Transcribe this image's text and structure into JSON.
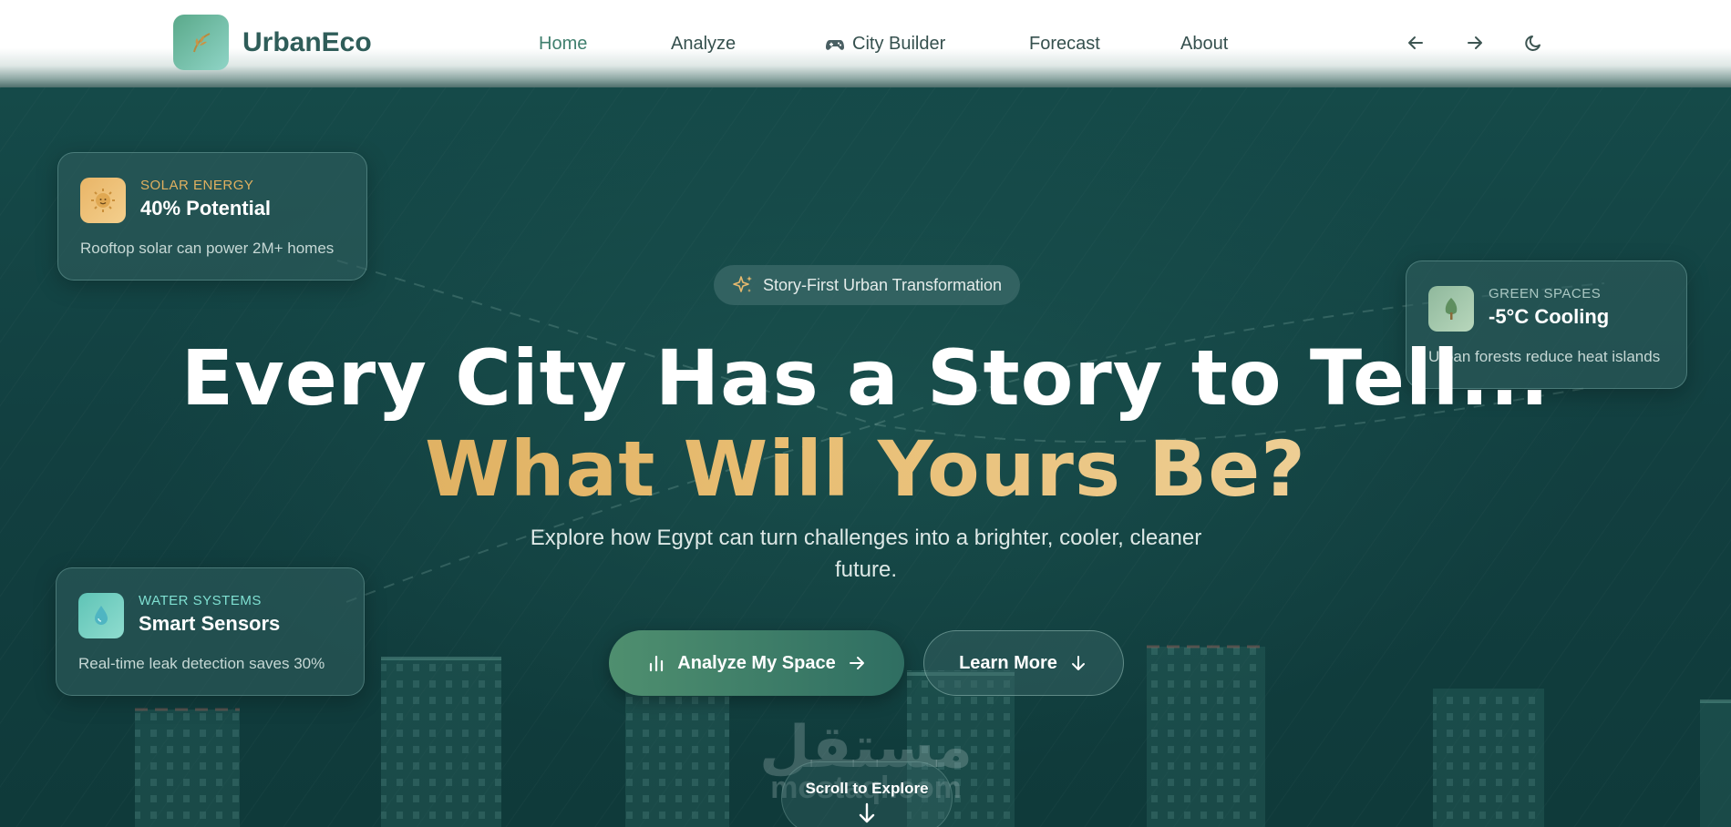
{
  "nav": {
    "brand": "UrbanEco",
    "logo_icon": "leaf-icon",
    "items": [
      {
        "label": "Home",
        "active": true
      },
      {
        "label": "Analyze",
        "active": false
      },
      {
        "label": "City Builder",
        "active": false,
        "icon": "gamepad-icon"
      },
      {
        "label": "Forecast",
        "active": false
      },
      {
        "label": "About",
        "active": false
      }
    ],
    "controls": [
      "arrow-left-icon",
      "arrow-right-icon",
      "moon-icon"
    ]
  },
  "cards": {
    "solar": {
      "kicker": "SOLAR ENERGY",
      "title": "40% Potential",
      "desc": "Rooftop solar can power 2M+ homes",
      "icon": "sun-icon",
      "kicker_color": "#e0b060"
    },
    "green": {
      "kicker": "GREEN SPACES",
      "title": "-5°C Cooling",
      "desc": "Urban forests reduce heat islands",
      "icon": "tree-icon",
      "kicker_color": "#a9c7c2"
    },
    "water": {
      "kicker": "WATER SYSTEMS",
      "title": "Smart Sensors",
      "desc": "Real-time leak detection saves 30%",
      "icon": "water-drop-icon",
      "kicker_color": "#7fe0d2"
    }
  },
  "hero": {
    "pill": "Story-First Urban Transformation",
    "pill_icon": "sparkles-icon",
    "headline": "Every City Has a Story to Tell...",
    "headline_accent": "What Will Yours Be?",
    "subtitle": "Explore how Egypt can turn challenges into a brighter, cooler, cleaner future.",
    "primary_cta": "Analyze My Space",
    "secondary_cta": "Learn More",
    "scroll_label": "Scroll to Explore"
  },
  "watermark": {
    "arabic": "مستقل",
    "latin": "mostaql.com"
  },
  "colors": {
    "accent_gold": "#e6b96e",
    "hero_bg": "#123f40",
    "brand_green": "#2f5d59"
  }
}
